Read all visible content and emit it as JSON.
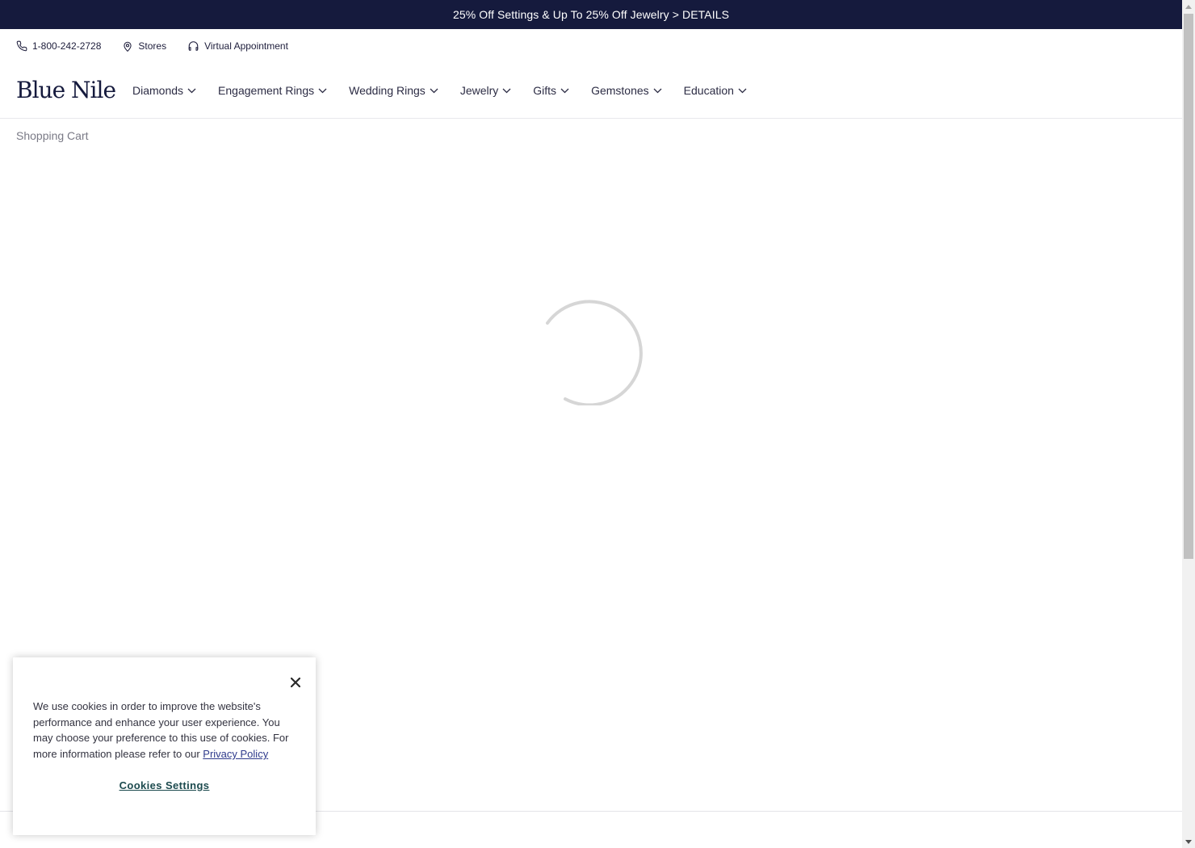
{
  "promo": {
    "text": "25% Off Settings & Up To 25% Off Jewelry > DETAILS"
  },
  "utility": {
    "phone": "1-800-242-2728",
    "stores": "Stores",
    "appointment": "Virtual Appointment"
  },
  "brand": {
    "logo": "Blue Nile"
  },
  "nav": {
    "items": [
      {
        "label": "Diamonds"
      },
      {
        "label": "Engagement Rings"
      },
      {
        "label": "Wedding Rings"
      },
      {
        "label": "Jewelry"
      },
      {
        "label": "Gifts"
      },
      {
        "label": "Gemstones"
      },
      {
        "label": "Education"
      }
    ]
  },
  "breadcrumb": {
    "current": "Shopping Cart"
  },
  "cookie_banner": {
    "text": "We use cookies in order to improve the website's performance and enhance your user experience. You may choose your preference to this use of cookies. For more information please refer to our ",
    "privacy_link": "Privacy Policy",
    "settings_button": "Cookies Settings"
  },
  "colors": {
    "promo_bg": "#151a3d",
    "brand": "#151a3d",
    "link": "#2e3a8c",
    "settings_link": "#1c4a4e"
  },
  "icons": {
    "phone": "phone-icon",
    "stores": "location-pin-icon",
    "appointment": "headset-icon",
    "nav_chevron": "chevron-down-icon",
    "close": "close-icon",
    "loading": "loading-spinner-icon"
  }
}
